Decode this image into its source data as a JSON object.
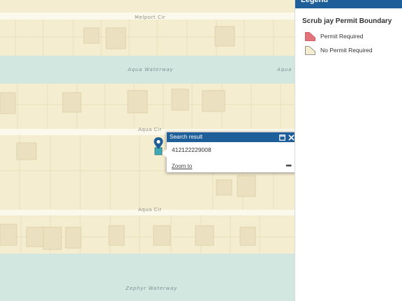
{
  "map": {
    "roads": [
      "Melport Cir",
      "Aqua Cir",
      "Aqua Cir"
    ],
    "waterways": [
      "Aqua Waterway",
      "Aqua W",
      "Zephyr Waterway"
    ]
  },
  "popup": {
    "title": "Search result",
    "value": "412122229008",
    "zoom_label": "Zoom to",
    "more_label": "•••"
  },
  "legend": {
    "header": "Legend",
    "layer_title": "Scrub jay Permit Boundary",
    "items": [
      {
        "label": "Permit Required",
        "color": "#e3737a"
      },
      {
        "label": "No Permit Required",
        "color": "#f5edcf"
      }
    ]
  },
  "colors": {
    "land": "#f5edcf",
    "water": "#d2e7df",
    "road": "#fbf8ec",
    "accent": "#1f5f99"
  }
}
